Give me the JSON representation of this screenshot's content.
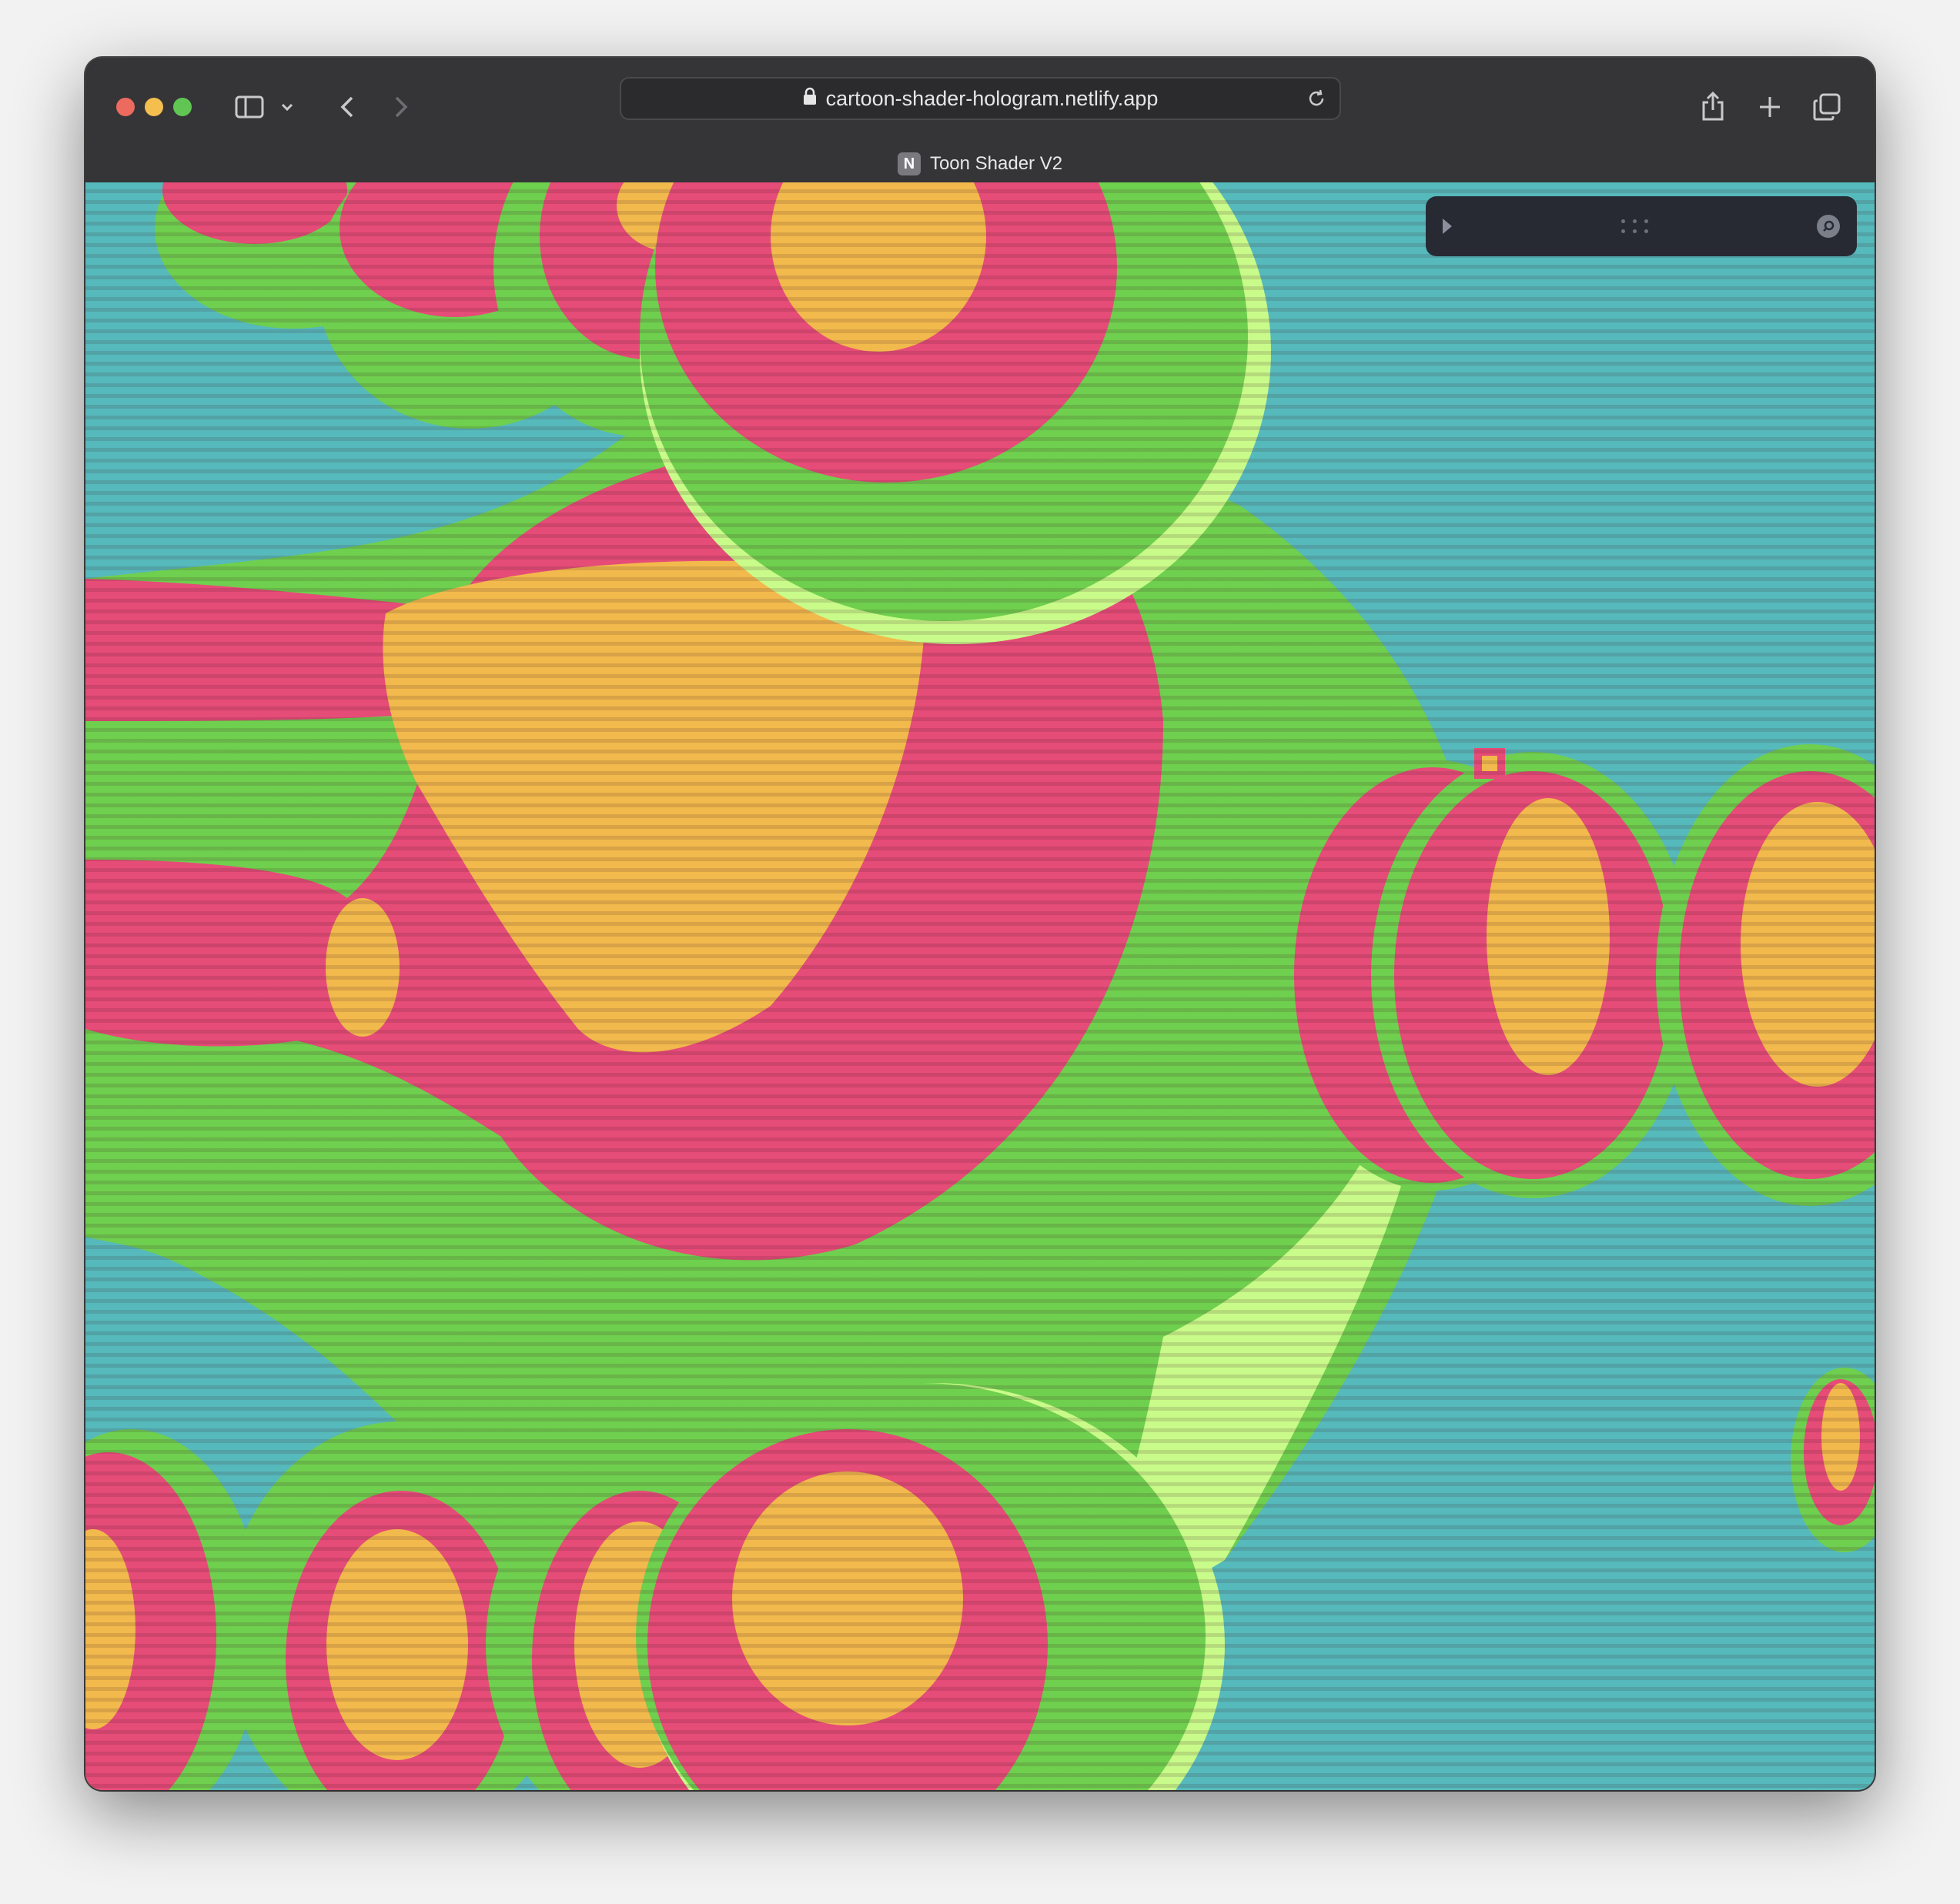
{
  "browser": {
    "url": "cartoon-shader-hologram.netlify.app",
    "tab": {
      "title": "Toon Shader V2",
      "favicon_letter": "N"
    }
  },
  "colors": {
    "background": "#56b9bb",
    "green": "#6fcf4e",
    "light_green": "#c9fb8a",
    "pink": "#e54c77",
    "yellow": "#f2b94c",
    "close": "#ed6a5e",
    "minimize": "#f4bf4f",
    "maximize": "#61c554"
  },
  "icons": [
    "sidebar-icon",
    "chevron-down-icon",
    "back-icon",
    "forward-icon",
    "lock-icon",
    "reload-icon",
    "share-icon",
    "new-tab-icon",
    "tab-overview-icon",
    "play-icon",
    "drag-handle-icon",
    "search-icon"
  ]
}
